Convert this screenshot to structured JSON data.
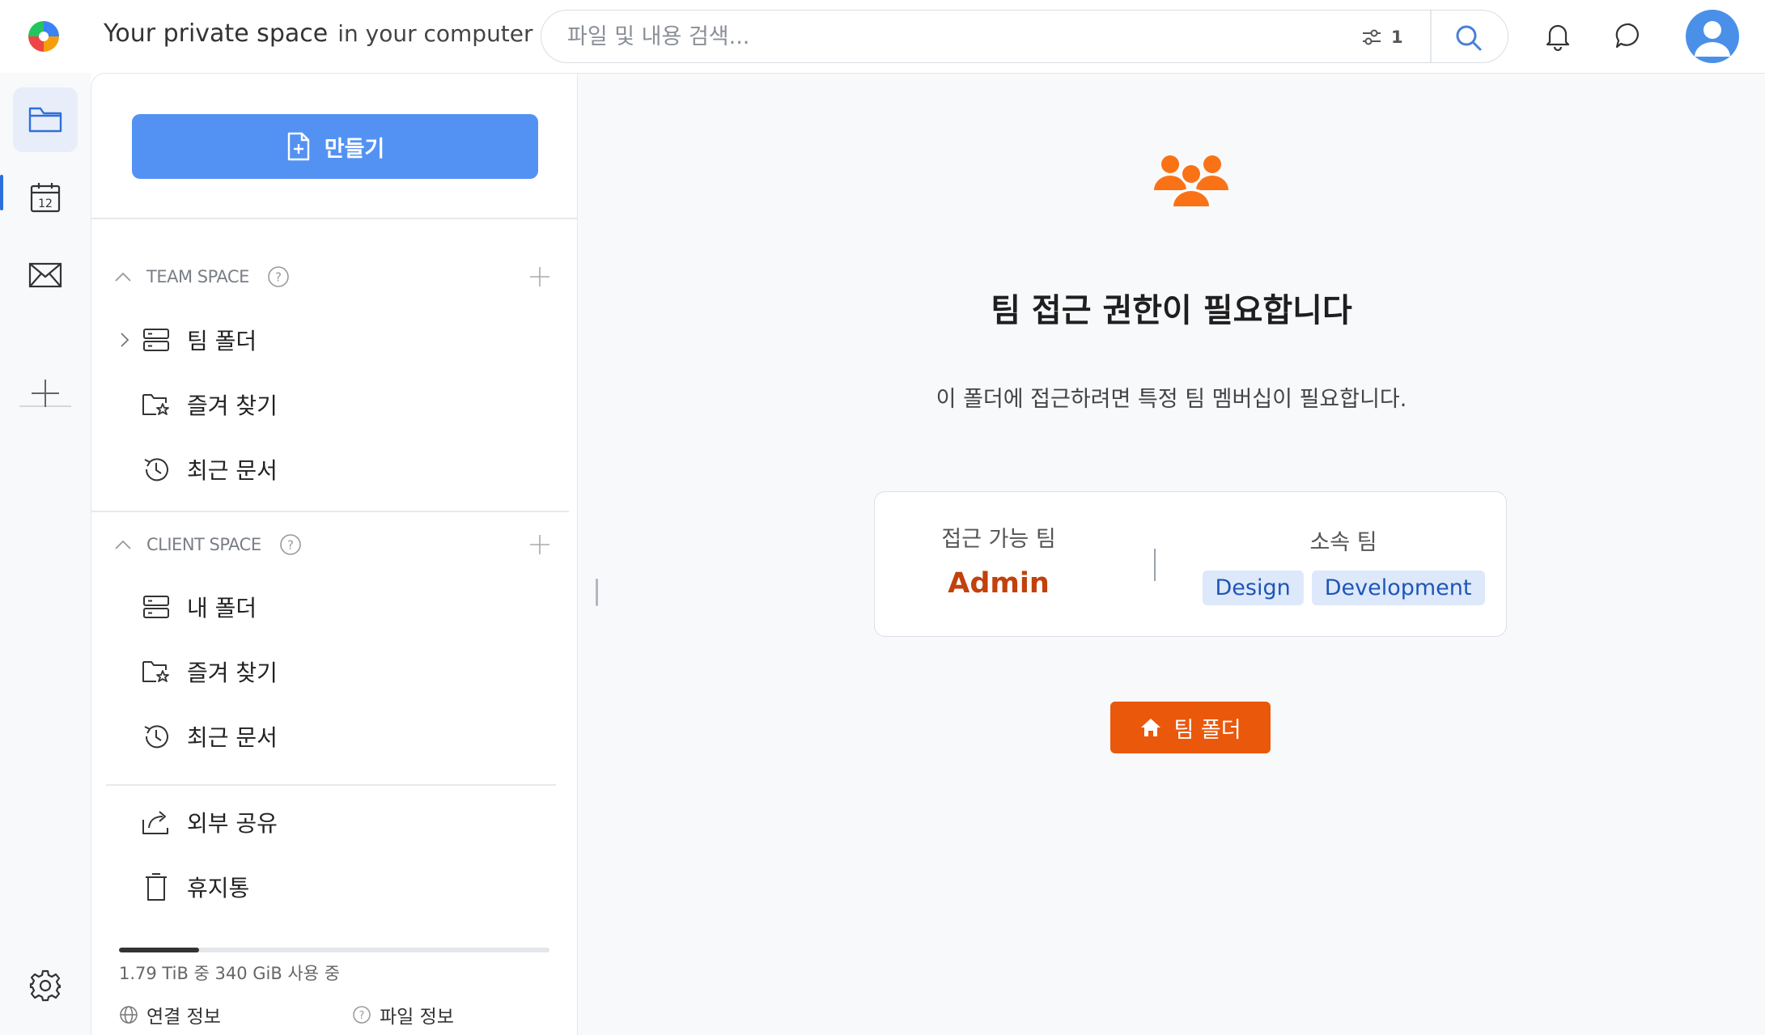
{
  "header": {
    "brand_main": "Your private space",
    "brand_sub": "in your computer",
    "search_placeholder": "파일 및 내용 검색...",
    "filter_count": "1",
    "colors": {
      "accent": "#5392f3",
      "avatar": "#4a90e8"
    }
  },
  "rail": {
    "items": [
      "folder-icon",
      "calendar-icon",
      "mail-icon",
      "plus-icon"
    ],
    "calendar_day": "12",
    "settings_icon": "gear-icon"
  },
  "sidebar": {
    "create_label": "만들기",
    "team_space": {
      "title": "TEAM SPACE",
      "items": [
        {
          "label": "팀 폴더",
          "icon": "server-icon"
        },
        {
          "label": "즐겨 찾기",
          "icon": "star-folder-icon"
        },
        {
          "label": "최근 문서",
          "icon": "history-icon"
        }
      ]
    },
    "client_space": {
      "title": "CLIENT SPACE",
      "items": [
        {
          "label": "내 폴더",
          "icon": "server-icon"
        },
        {
          "label": "즐겨 찾기",
          "icon": "star-folder-icon"
        },
        {
          "label": "최근 문서",
          "icon": "history-icon"
        }
      ]
    },
    "extra": [
      {
        "label": "외부 공유",
        "icon": "share-icon"
      },
      {
        "label": "휴지통",
        "icon": "trash-icon"
      }
    ],
    "usage": {
      "text": "1.79 TiB 중 340 GiB 사용 중",
      "fraction": 0.1855
    },
    "footer": {
      "connection": "연결 정보",
      "file_info": "파일 정보"
    }
  },
  "main": {
    "title": "팀 접근 권한이 필요합니다",
    "description": "이 폴더에 접근하려면 특정 팀 멤버십이 필요합니다.",
    "card": {
      "accessible_label": "접근 가능 팀",
      "accessible_team": "Admin",
      "member_label": "소속 팀",
      "member_teams": [
        "Design",
        "Development"
      ]
    },
    "button_label": "팀 폴더",
    "colors": {
      "primary": "#ea580c",
      "admin": "#c2410c",
      "chip_bg": "#dde9fb",
      "chip_text": "#1f55b8"
    }
  }
}
